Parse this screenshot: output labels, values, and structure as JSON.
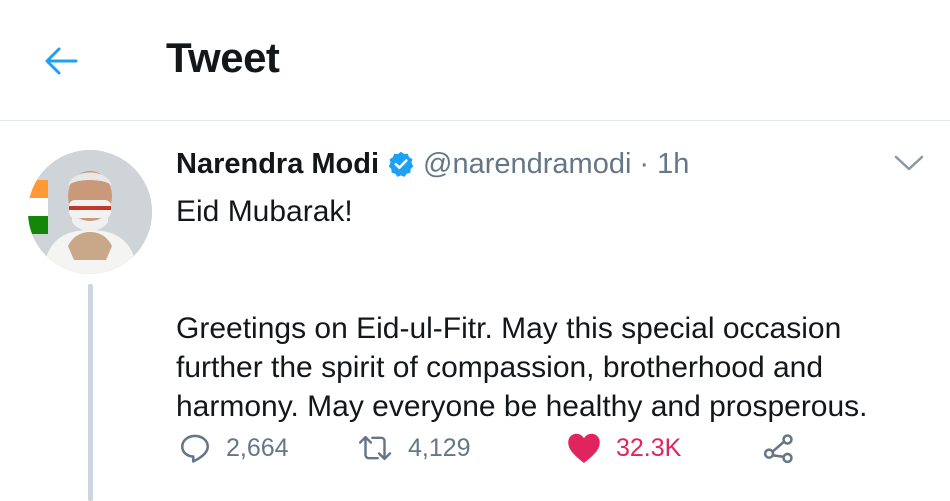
{
  "header": {
    "title": "Tweet"
  },
  "author": {
    "name": "Narendra Modi",
    "handle": "@narendramodi",
    "separator": "·",
    "time": "1h",
    "verified": true
  },
  "tweet": {
    "line1": "Eid Mubarak!",
    "line2": "Greetings on Eid-ul-Fitr. May this special occasion further the spirit of compassion, brotherhood and harmony. May everyone be healthy and prosperous."
  },
  "actions": {
    "replies": "2,664",
    "retweets": "4,129",
    "likes": "32.3K"
  },
  "colors": {
    "accent": "#1da1f2",
    "like": "#e0245e",
    "muted": "#657786"
  }
}
